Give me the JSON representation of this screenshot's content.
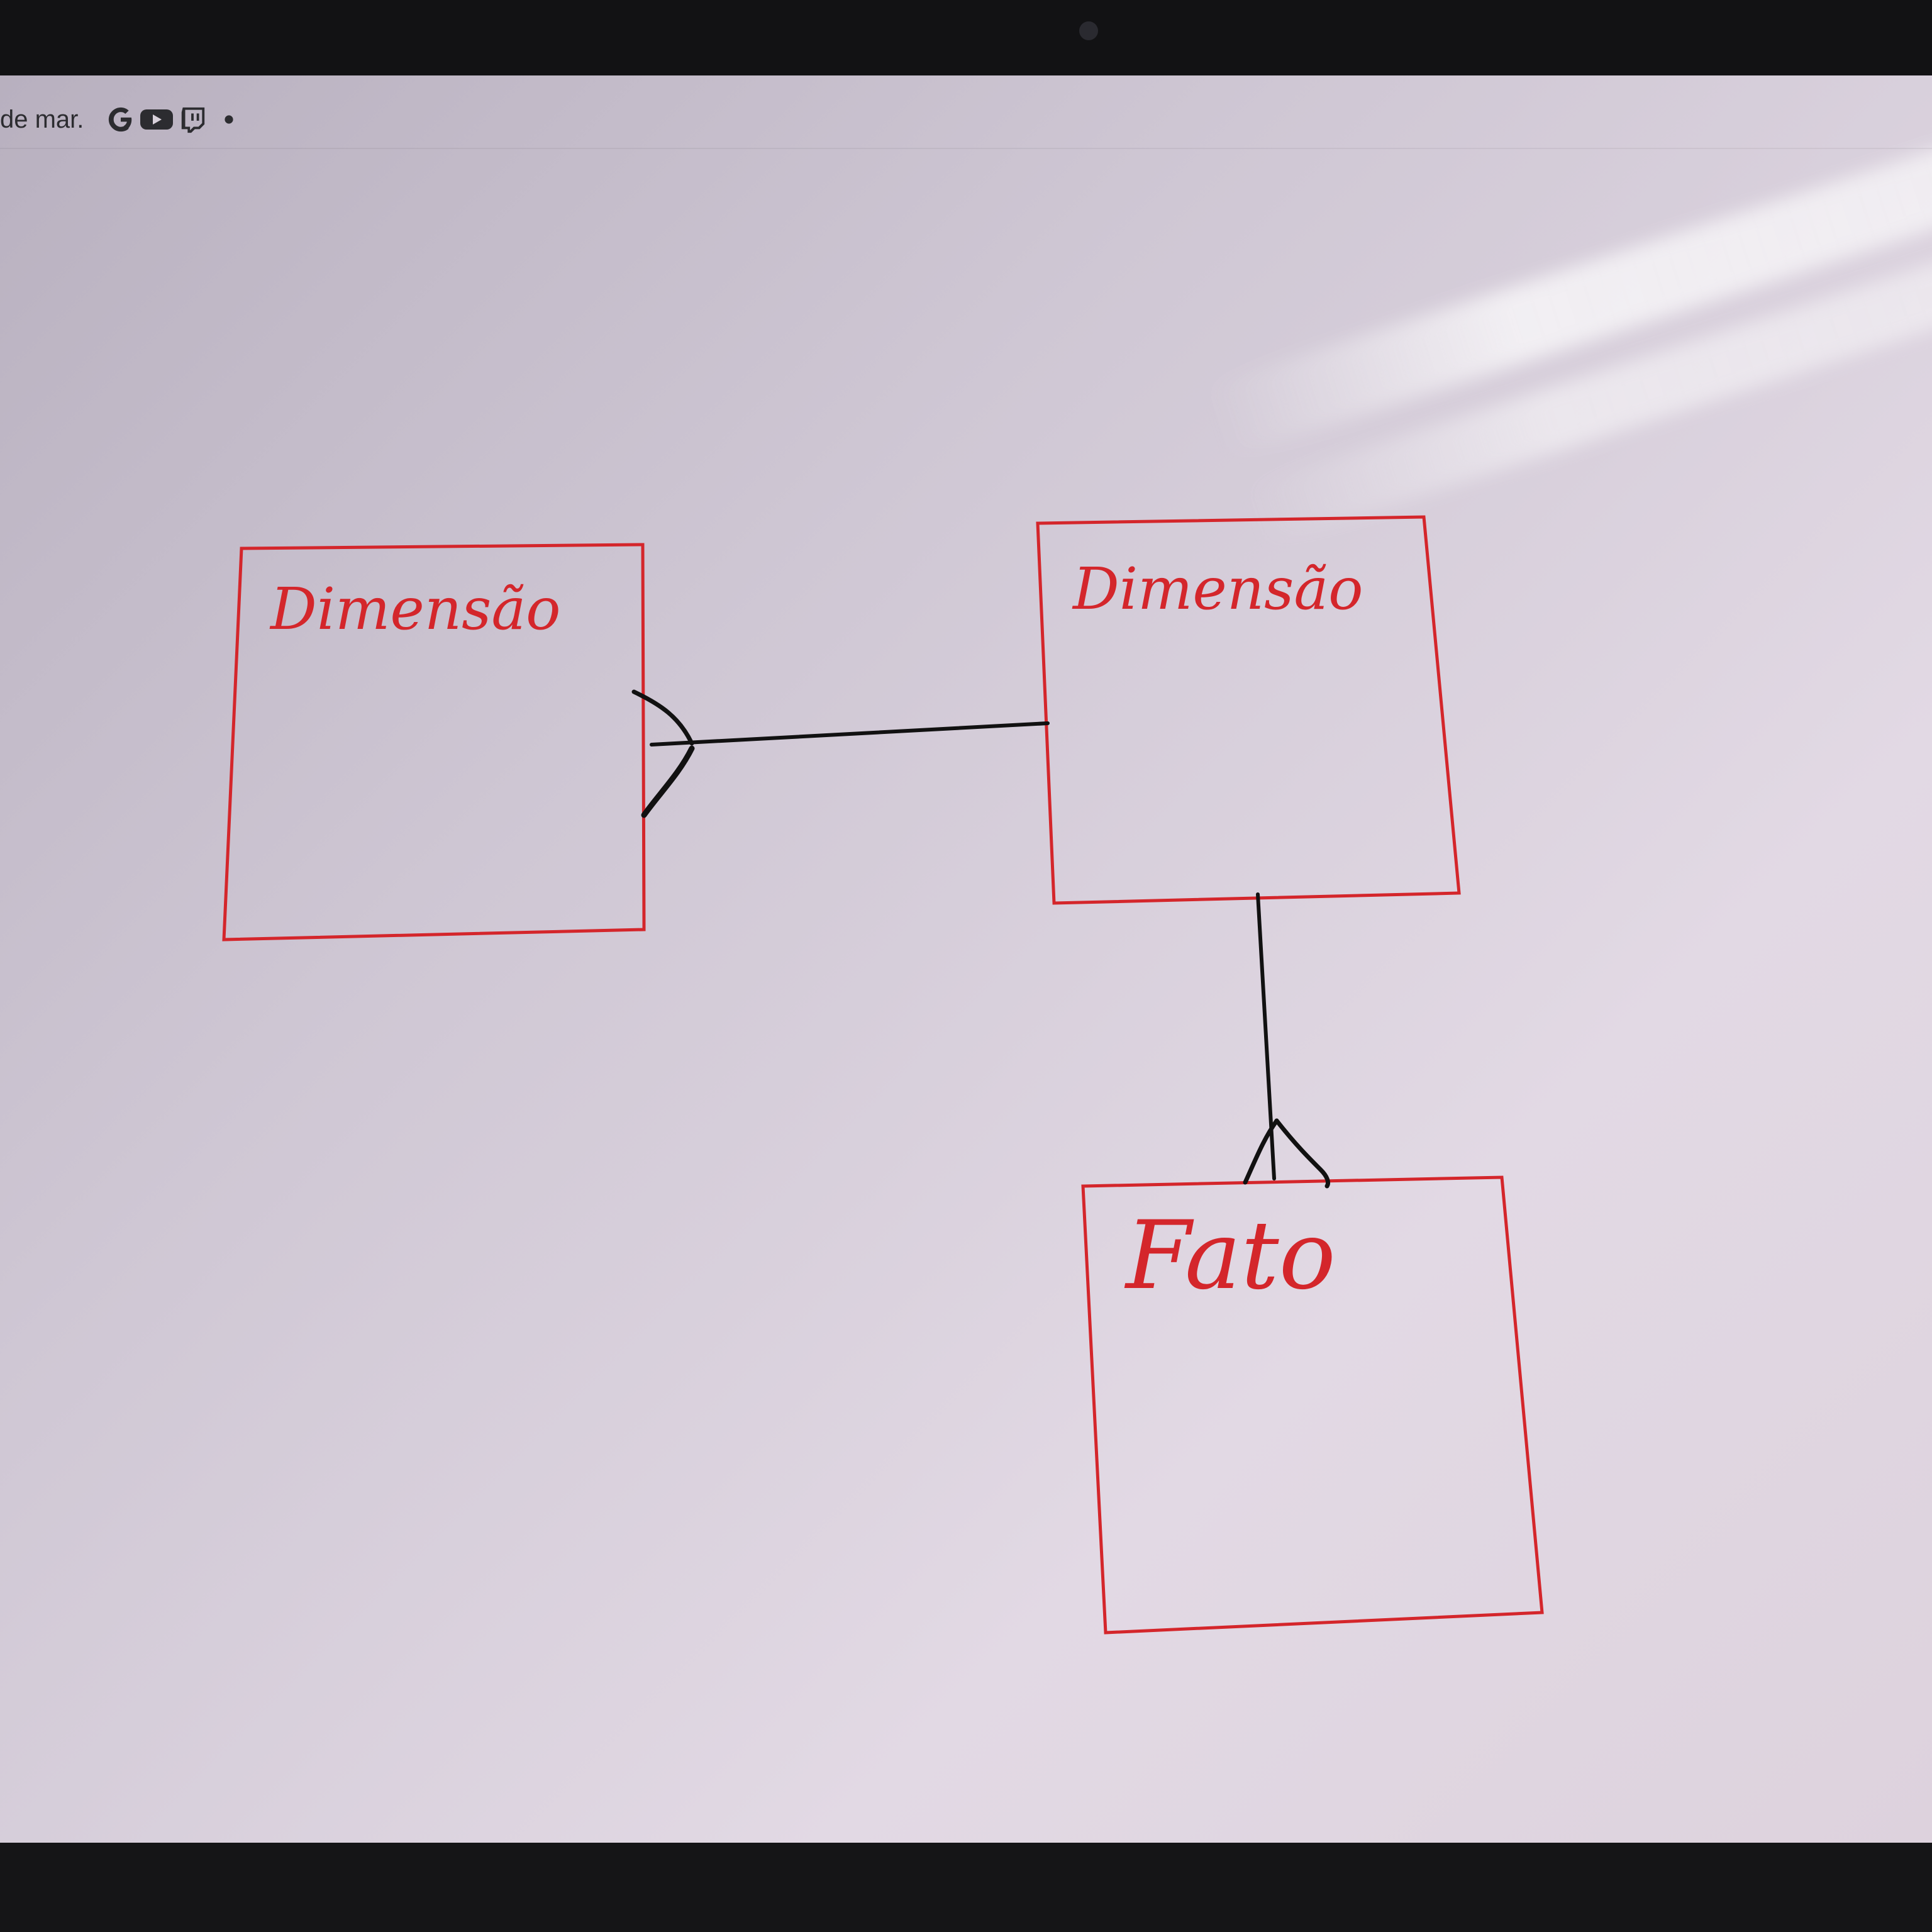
{
  "toolbar": {
    "date_text": "de mar.",
    "icons": [
      "google-icon",
      "youtube-icon",
      "twitch-icon",
      "dot-icon"
    ]
  },
  "diagram": {
    "entities": [
      {
        "id": "dim1",
        "label": "Dimensão"
      },
      {
        "id": "dim2",
        "label": "Dimensão"
      },
      {
        "id": "fact",
        "label": "Fato"
      }
    ],
    "relationships": [
      {
        "from": "dim2",
        "to": "dim1",
        "end_at_dim1": "crow-foot (many)"
      },
      {
        "from": "dim2",
        "to": "fact",
        "end_at_fact": "crow-foot (many)"
      }
    ],
    "colors": {
      "entity_border": "#d4262b",
      "connector": "#111111"
    }
  }
}
